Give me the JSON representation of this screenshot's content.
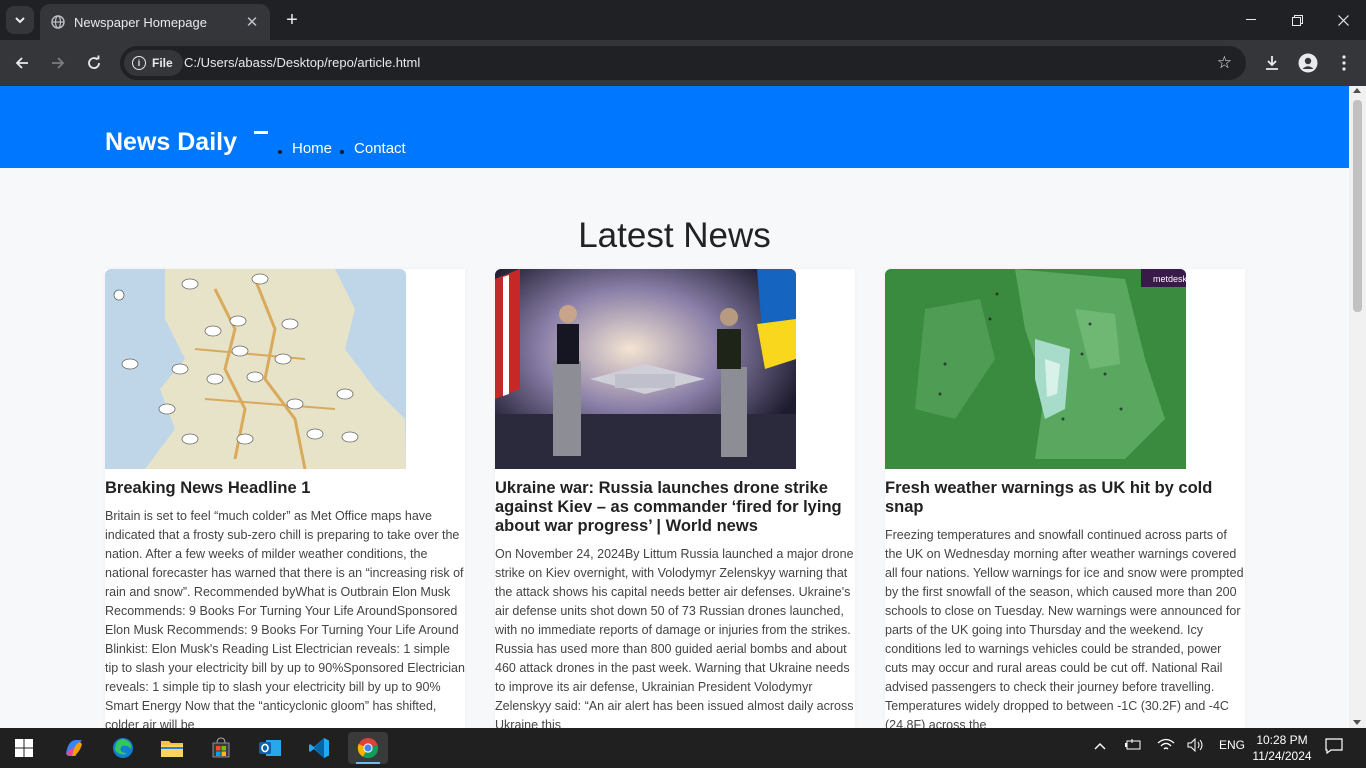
{
  "browser": {
    "tab_title": "Newspaper Homepage",
    "url_chip": "File",
    "url": "C:/Users/abass/Desktop/repo/article.html"
  },
  "site": {
    "logo": "News Daily",
    "nav": [
      "Home",
      "Contact"
    ],
    "section_title": "Latest News",
    "brand_color": "#0077ff"
  },
  "articles": [
    {
      "title": "Breaking News Headline 1",
      "body": "Britain is set to feel “much colder” as Met Office maps have indicated that a frosty sub-zero chill is preparing to take over the nation. After a few weeks of milder weather conditions, the national forecaster has warned that there is an “increasing risk of rain and snow”. Recommended byWhat is Outbrain Elon Musk Recommends: 9 Books For Turning Your Life AroundSponsored Elon Musk Recommends: 9 Books For Turning Your Life Around Blinkist: Elon Musk's Reading List Electrician reveals: 1 simple tip to slash your electricity bill by up to 90%Sponsored Electrician reveals: 1 simple tip to slash your electricity bill by up to 90% Smart Energy Now that the “anticyclonic gloom” has shifted, colder air will be",
      "image": "uk-weather-map"
    },
    {
      "title": "Ukraine war: Russia launches drone strike against Kiev – as commander ‘fired for lying about war progress’ | World news",
      "body": "On November 24, 2024By Littum Russia launched a major drone strike on Kiev overnight, with Volodymyr Zelenskyy warning that the attack shows his capital needs better air defenses. Ukraine's air defense units shot down 50 of 73 Russian drones launched, with no immediate reports of damage or injuries from the strikes. Russia has used more than 800 guided aerial bombs and about 460 attack drones in the past week. Warning that Ukraine needs to improve its air defense, Ukrainian President Volodymyr Zelenskyy said: “An air alert has been issued almost daily across Ukraine this",
      "image": "press-conference-photo"
    },
    {
      "title": "Fresh weather warnings as UK hit by cold snap",
      "body": "Freezing temperatures and snowfall continued across parts of the UK on Wednesday morning after weather warnings covered all four nations. Yellow warnings for ice and snow were prompted by the first snowfall of the season, which caused more than 200 schools to close on Tuesday. New warnings were announced for parts of the UK going into Thursday and the weekend. Icy conditions led to warnings vehicles could be stranded, power cuts may occur and rural areas could be cut off. National Rail advised passengers to check their journey before travelling. Temperatures widely dropped to between -1C (30.2F) and -4C (24.8F) across the",
      "image": "metdesk-snow-map",
      "image_brand": "metdesk"
    }
  ],
  "taskbar": {
    "time": "10:28 PM",
    "date": "11/24/2024",
    "lang": "ENG",
    "apps": [
      "start-icon",
      "copilot-icon",
      "edge-icon",
      "file-explorer-icon",
      "store-icon",
      "outlook-icon",
      "vscode-icon",
      "chrome-icon"
    ]
  }
}
